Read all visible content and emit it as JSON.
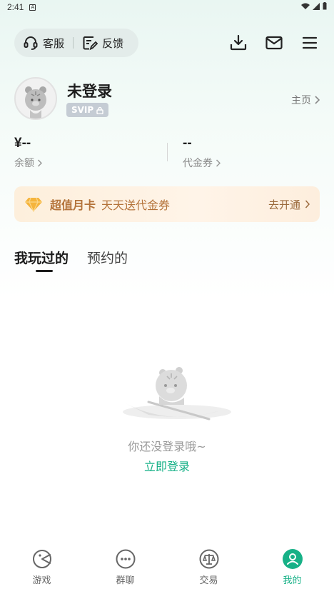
{
  "status_bar": {
    "time": "2:41"
  },
  "header": {
    "service_label": "客服",
    "feedback_label": "反馈"
  },
  "profile": {
    "username": "未登录",
    "badge": "SVIP",
    "homepage_label": "主页"
  },
  "wallet": {
    "balance_value": "¥--",
    "balance_label": "余额",
    "voucher_value": "--",
    "voucher_label": "代金券"
  },
  "banner": {
    "title": "超值月卡",
    "subtitle": "天天送代金券",
    "cta": "去开通"
  },
  "tabs": [
    {
      "label": "我玩过的",
      "active": true
    },
    {
      "label": "预约的",
      "active": false
    }
  ],
  "empty_state": {
    "message": "你还没登录哦~",
    "login_link": "立即登录"
  },
  "tabbar": [
    {
      "label": "游戏",
      "icon": "game-icon",
      "active": false
    },
    {
      "label": "群聊",
      "icon": "chat-icon",
      "active": false
    },
    {
      "label": "交易",
      "icon": "trade-icon",
      "active": false
    },
    {
      "label": "我的",
      "icon": "profile-icon",
      "active": true
    }
  ],
  "colors": {
    "accent": "#17b187",
    "banner_text": "#b4733a"
  }
}
